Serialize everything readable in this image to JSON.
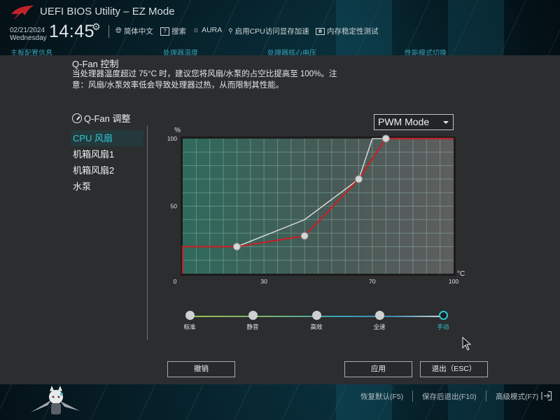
{
  "header": {
    "title": "UEFI BIOS Utility – EZ Mode",
    "date": "02/21/2024",
    "weekday": "Wednesday",
    "time": "14:45",
    "items": [
      {
        "icon": "globe-icon",
        "label": "简体中文"
      },
      {
        "icon": "search-help-icon",
        "label": "搜索"
      },
      {
        "icon": "aura-icon",
        "label": "AURA"
      },
      {
        "icon": "resizable-bar-icon",
        "label": "启用CPU访问显存加速"
      },
      {
        "icon": "memtest-icon",
        "label": "内存稳定性测试"
      }
    ],
    "background_tabs": [
      "主板配置信息",
      "处理器温度",
      "处理器核心电压",
      "性能模式切换"
    ]
  },
  "modal": {
    "title": "Q-Fan 控制",
    "description": "当处理器温度超过 75°C 时，建议您将风扇/水泵的占空比提高至 100%。注意：风扇/水泵效率低会导致处理器过热，从而限制其性能。",
    "tune_title": "Q-Fan 调整",
    "fans": [
      {
        "label": "CPU 风扇",
        "selected": true
      },
      {
        "label": "机箱风扇1",
        "selected": false
      },
      {
        "label": "机箱风扇2",
        "selected": false
      },
      {
        "label": "水泵",
        "selected": false
      }
    ],
    "mode_select": {
      "value": "PWM Mode"
    },
    "presets": [
      {
        "label": "标准",
        "selected": false
      },
      {
        "label": "静音",
        "selected": false
      },
      {
        "label": "高效",
        "selected": false
      },
      {
        "label": "全速",
        "selected": false
      },
      {
        "label": "手动",
        "selected": true
      }
    ],
    "buttons": {
      "cancel": "撤销",
      "apply": "应用",
      "exit": "退出（ESC）"
    }
  },
  "footer": {
    "items": [
      "恢复默认(F5)",
      "保存后退出(F10)",
      "高级模式(F7)"
    ]
  },
  "colors": {
    "accent": "#2fc8d6",
    "curve": "#c0232a",
    "reference_curve": "#e8e8e8",
    "modal_bg": "#2c2d2f"
  },
  "chart_data": {
    "type": "line",
    "title": "",
    "xlabel": "°C",
    "ylabel": "%",
    "xlim": [
      0,
      100
    ],
    "ylim": [
      0,
      100
    ],
    "x_ticks": [
      0,
      30,
      70,
      100
    ],
    "y_ticks": [
      0,
      50,
      100
    ],
    "grid": true,
    "grid_x_step": 5,
    "grid_y_step": 10,
    "series": [
      {
        "name": "current-curve",
        "color": "#c0232a",
        "points": [
          [
            0,
            0
          ],
          [
            0,
            20
          ],
          [
            20,
            20
          ],
          [
            45,
            28
          ],
          [
            65,
            70
          ],
          [
            75,
            100
          ],
          [
            100,
            100
          ]
        ],
        "control_points": [
          [
            20,
            20
          ],
          [
            45,
            28
          ],
          [
            65,
            70
          ],
          [
            75,
            100
          ]
        ]
      },
      {
        "name": "reference-curve",
        "color": "#e8e8e8",
        "points": [
          [
            20,
            20
          ],
          [
            45,
            40
          ],
          [
            65,
            70
          ],
          [
            70,
            100
          ],
          [
            75,
            100
          ]
        ]
      }
    ]
  }
}
